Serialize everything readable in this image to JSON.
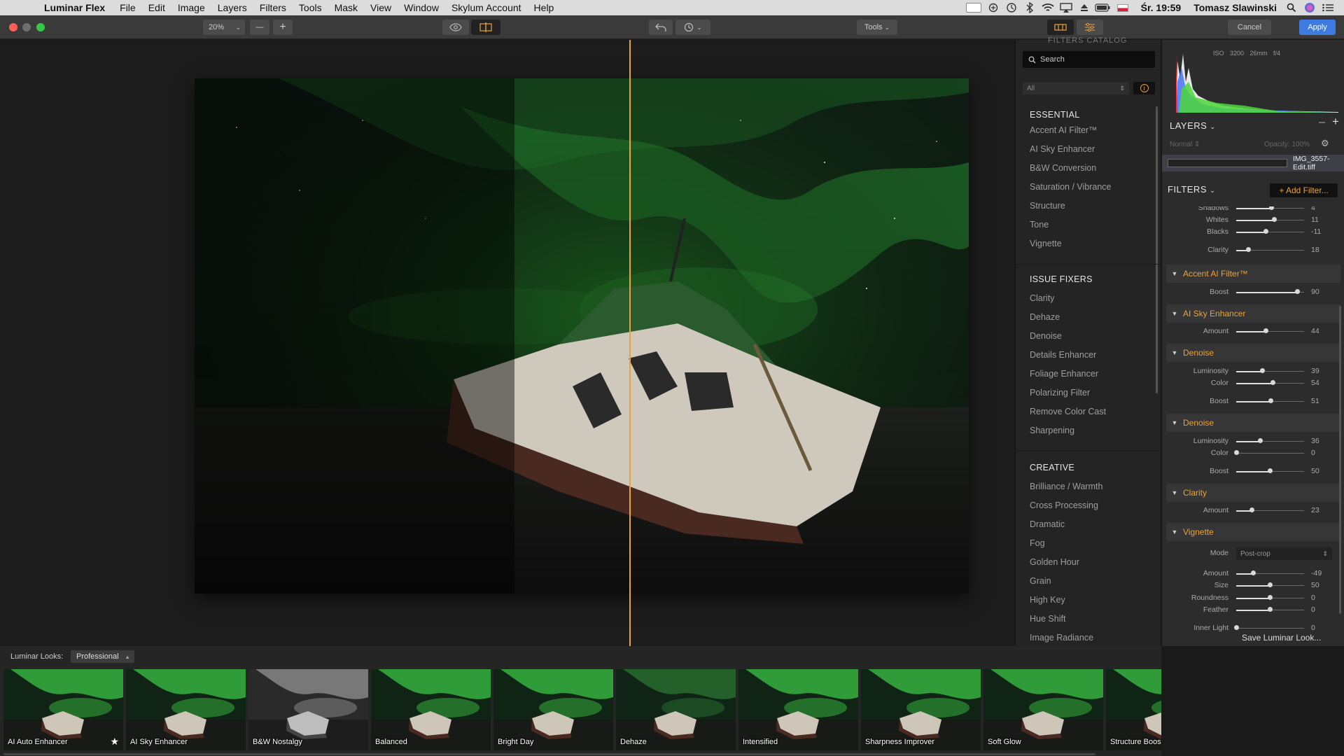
{
  "menubar": {
    "apple_glyph": "",
    "app_name": "Luminar Flex",
    "items": [
      "File",
      "Edit",
      "Image",
      "Layers",
      "Filters",
      "Tools",
      "Mask",
      "View",
      "Window",
      "Skylum Account",
      "Help"
    ],
    "clock": "Śr. 19:59",
    "user": "Tomasz Slawinski"
  },
  "toolbar": {
    "zoom": "20%",
    "zoom_out": "—",
    "zoom_in": "+",
    "tools_label": "Tools",
    "cancel_label": "Cancel",
    "apply_label": "Apply",
    "accent": "#e8a33c",
    "apply_color": "#3d7be0"
  },
  "catalog": {
    "title": "FILTERS CATALOG",
    "search_placeholder": "Search",
    "filter_select": "All",
    "sections": [
      {
        "title": "ESSENTIAL",
        "items": [
          "Accent AI Filter™",
          "AI Sky Enhancer",
          "B&W Conversion",
          "Saturation / Vibrance",
          "Structure",
          "Tone",
          "Vignette"
        ]
      },
      {
        "title": "ISSUE FIXERS",
        "items": [
          "Clarity",
          "Dehaze",
          "Denoise",
          "Details Enhancer",
          "Foliage Enhancer",
          "Polarizing Filter",
          "Remove Color Cast",
          "Sharpening"
        ]
      },
      {
        "title": "CREATIVE",
        "items": [
          "Brilliance / Warmth",
          "Cross Processing",
          "Dramatic",
          "Fog",
          "Golden Hour",
          "Grain",
          "High Key",
          "Hue Shift",
          "Image Radiance"
        ]
      }
    ]
  },
  "histogram_info": "ISO 3200   26mm   f/4",
  "layers": {
    "title": "LAYERS",
    "blend_mode": "Normal",
    "opacity": "Opacity: 100%",
    "file": "IMG_3557-Edit.tiff"
  },
  "filters_panel": {
    "title": "FILTERS",
    "add_label": "+ Add Filter...",
    "tone_rows": [
      {
        "label": "Shadows",
        "value": "4",
        "pos": 0.52
      },
      {
        "label": "Whites",
        "value": "11",
        "pos": 0.56
      },
      {
        "label": "Blacks",
        "value": "-11",
        "pos": 0.44
      },
      {
        "label": "Clarity",
        "value": "18",
        "pos": 0.18
      }
    ],
    "accent_ai": {
      "title": "Accent AI Filter™",
      "rows": [
        {
          "label": "Boost",
          "value": "90",
          "pos": 0.9
        }
      ]
    },
    "ai_sky": {
      "title": "AI Sky Enhancer",
      "rows": [
        {
          "label": "Amount",
          "value": "44",
          "pos": 0.44
        }
      ]
    },
    "denoise1": {
      "title": "Denoise",
      "rows": [
        {
          "label": "Luminosity",
          "value": "39",
          "pos": 0.39
        },
        {
          "label": "Color",
          "value": "54",
          "pos": 0.54
        },
        {
          "label": "Boost",
          "value": "51",
          "pos": 0.51
        }
      ]
    },
    "denoise2": {
      "title": "Denoise",
      "rows": [
        {
          "label": "Luminosity",
          "value": "36",
          "pos": 0.36
        },
        {
          "label": "Color",
          "value": "0",
          "pos": 0.0
        },
        {
          "label": "Boost",
          "value": "50",
          "pos": 0.5
        }
      ]
    },
    "clarity": {
      "title": "Clarity",
      "rows": [
        {
          "label": "Amount",
          "value": "23",
          "pos": 0.23
        }
      ]
    },
    "vignette": {
      "title": "Vignette",
      "mode_label": "Mode",
      "mode_value": "Post-crop",
      "rows": [
        {
          "label": "Amount",
          "value": "-49",
          "pos": 0.255
        },
        {
          "label": "Size",
          "value": "50",
          "pos": 0.5
        },
        {
          "label": "Roundness",
          "value": "0",
          "pos": 0.5
        },
        {
          "label": "Feather",
          "value": "0",
          "pos": 0.5
        },
        {
          "label": "Inner Light",
          "value": "0",
          "pos": 0.0
        }
      ]
    },
    "save_look": "Save Luminar Look..."
  },
  "looks": {
    "label": "Luminar Looks:",
    "category": "Professional",
    "items": [
      "AI Auto Enhancer",
      "AI Sky Enhancer",
      "B&W Nostalgy",
      "Balanced",
      "Bright Day",
      "Dehaze",
      "Intensified",
      "Sharpness Improver",
      "Soft Glow",
      "Structure Boost"
    ]
  }
}
